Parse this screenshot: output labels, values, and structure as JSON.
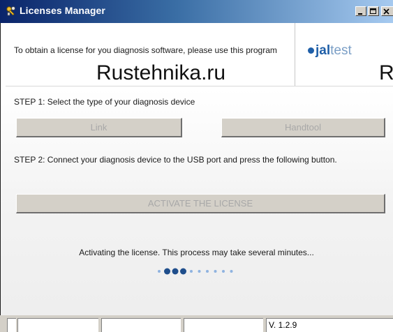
{
  "window": {
    "title": "Licenses Manager",
    "title_icon": "key-icon",
    "controls": [
      "minimize-icon",
      "maximize-icon",
      "close-icon"
    ]
  },
  "header": {
    "info_text": "To obtain a license for you diagnosis software, please use this program",
    "watermark": "Rustehnika.ru",
    "watermark_edge": "R",
    "logo": {
      "part1": "jal",
      "part2": "test",
      "color": "#1f5fa8"
    }
  },
  "step1": {
    "text": "STEP 1: Select the type of your diagnosis device",
    "buttons": {
      "link": "Link",
      "handtool": "Handtool"
    }
  },
  "step2": {
    "text": "STEP 2: Connect your diagnosis device to the USB port and press the following button.",
    "activate_label": "ACTIVATE THE LICENSE"
  },
  "status": {
    "message": "Activating the license. This process may take several minutes...",
    "progress_dots_total": 10,
    "progress_active": [
      1,
      2,
      3
    ],
    "active_color": "#1f4e8c",
    "inactive_color": "#8fb3e0"
  },
  "statusbar": {
    "cells": [
      "",
      "",
      "",
      "",
      "V. 1.2.9"
    ]
  }
}
